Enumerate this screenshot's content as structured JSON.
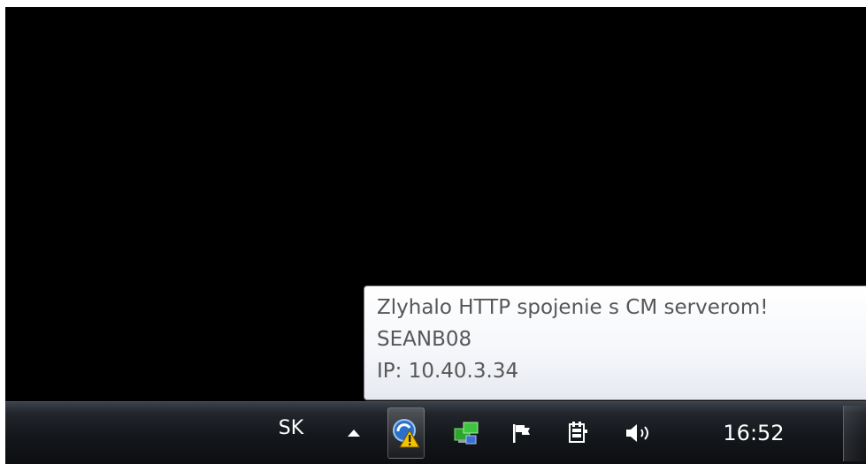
{
  "tooltip": {
    "line1": "Zlyhalo HTTP spojenie s CM serverom!",
    "line2": "SEANB08",
    "line3": "IP: 10.40.3.34"
  },
  "taskbar": {
    "language": "SK",
    "clock": "16:52",
    "tray_icons": [
      "cm-client-warning-icon",
      "network-icon",
      "action-center-flag-icon",
      "power-icon",
      "volume-icon"
    ]
  },
  "colors": {
    "desktop": "#000000",
    "taskbar": "#14171b",
    "tooltip_text": "#575757",
    "warning": "#f5c400"
  }
}
